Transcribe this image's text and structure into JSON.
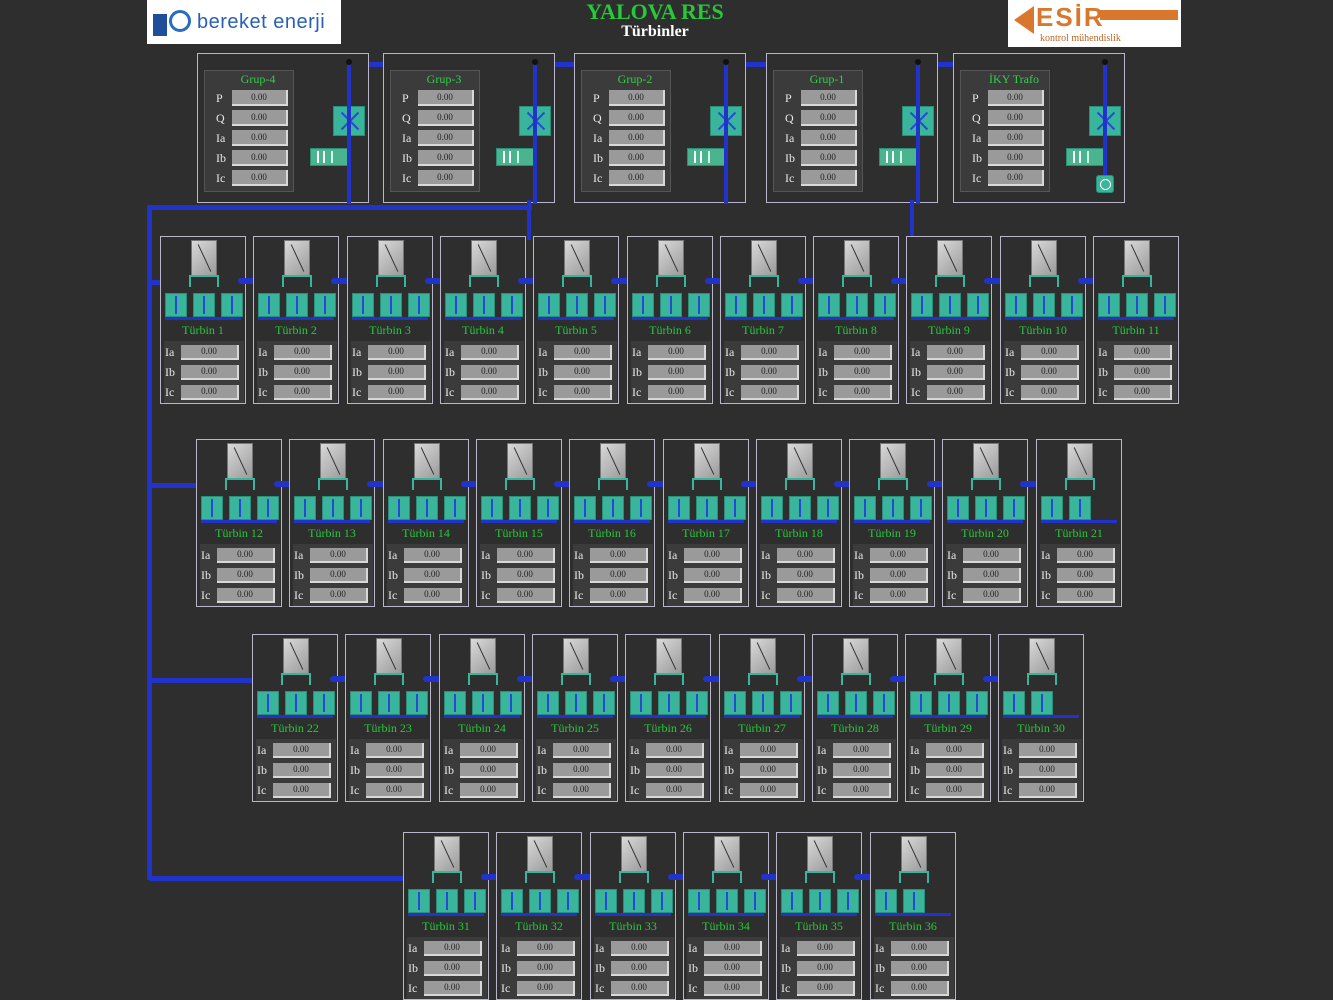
{
  "header": {
    "title": "YALOVA RES",
    "subtitle": "Türbinler",
    "left_logo": "bereket enerji",
    "right_logo": "ESİR",
    "right_logo_sub": "kontrol mühendislik"
  },
  "feeders": [
    {
      "name": "Grup-4",
      "rows": [
        {
          "label": "P",
          "value": "0.00"
        },
        {
          "label": "Q",
          "value": "0.00"
        },
        {
          "label": "Ia",
          "value": "0.00"
        },
        {
          "label": "Ib",
          "value": "0.00"
        },
        {
          "label": "Ic",
          "value": "0.00"
        }
      ]
    },
    {
      "name": "Grup-3",
      "rows": [
        {
          "label": "P",
          "value": "0.00"
        },
        {
          "label": "Q",
          "value": "0.00"
        },
        {
          "label": "Ia",
          "value": "0.00"
        },
        {
          "label": "Ib",
          "value": "0.00"
        },
        {
          "label": "Ic",
          "value": "0.00"
        }
      ]
    },
    {
      "name": "Grup-2",
      "rows": [
        {
          "label": "P",
          "value": "0.00"
        },
        {
          "label": "Q",
          "value": "0.00"
        },
        {
          "label": "Ia",
          "value": "0.00"
        },
        {
          "label": "Ib",
          "value": "0.00"
        },
        {
          "label": "Ic",
          "value": "0.00"
        }
      ]
    },
    {
      "name": "Grup-1",
      "rows": [
        {
          "label": "P",
          "value": "0.00"
        },
        {
          "label": "Q",
          "value": "0.00"
        },
        {
          "label": "Ia",
          "value": "0.00"
        },
        {
          "label": "Ib",
          "value": "0.00"
        },
        {
          "label": "Ic",
          "value": "0.00"
        }
      ]
    },
    {
      "name": "İKY Trafo",
      "rows": [
        {
          "label": "P",
          "value": "0.00"
        },
        {
          "label": "Q",
          "value": "0.00"
        },
        {
          "label": "Ia",
          "value": "0.00"
        },
        {
          "label": "Ib",
          "value": "0.00"
        },
        {
          "label": "Ic",
          "value": "0.00"
        }
      ]
    }
  ],
  "turbines": [
    {
      "name": "Türbin 1",
      "ia": "0.00",
      "ib": "0.00",
      "ic": "0.00"
    },
    {
      "name": "Türbin 2",
      "ia": "0.00",
      "ib": "0.00",
      "ic": "0.00"
    },
    {
      "name": "Türbin 3",
      "ia": "0.00",
      "ib": "0.00",
      "ic": "0.00"
    },
    {
      "name": "Türbin 4",
      "ia": "0.00",
      "ib": "0.00",
      "ic": "0.00"
    },
    {
      "name": "Türbin 5",
      "ia": "0.00",
      "ib": "0.00",
      "ic": "0.00"
    },
    {
      "name": "Türbin 6",
      "ia": "0.00",
      "ib": "0.00",
      "ic": "0.00"
    },
    {
      "name": "Türbin 7",
      "ia": "0.00",
      "ib": "0.00",
      "ic": "0.00"
    },
    {
      "name": "Türbin 8",
      "ia": "0.00",
      "ib": "0.00",
      "ic": "0.00"
    },
    {
      "name": "Türbin 9",
      "ia": "0.00",
      "ib": "0.00",
      "ic": "0.00"
    },
    {
      "name": "Türbin 10",
      "ia": "0.00",
      "ib": "0.00",
      "ic": "0.00"
    },
    {
      "name": "Türbin 11",
      "ia": "0.00",
      "ib": "0.00",
      "ic": "0.00"
    },
    {
      "name": "Türbin 12",
      "ia": "0.00",
      "ib": "0.00",
      "ic": "0.00"
    },
    {
      "name": "Türbin 13",
      "ia": "0.00",
      "ib": "0.00",
      "ic": "0.00"
    },
    {
      "name": "Türbin 14",
      "ia": "0.00",
      "ib": "0.00",
      "ic": "0.00"
    },
    {
      "name": "Türbin 15",
      "ia": "0.00",
      "ib": "0.00",
      "ic": "0.00"
    },
    {
      "name": "Türbin 16",
      "ia": "0.00",
      "ib": "0.00",
      "ic": "0.00"
    },
    {
      "name": "Türbin 17",
      "ia": "0.00",
      "ib": "0.00",
      "ic": "0.00"
    },
    {
      "name": "Türbin 18",
      "ia": "0.00",
      "ib": "0.00",
      "ic": "0.00"
    },
    {
      "name": "Türbin 19",
      "ia": "0.00",
      "ib": "0.00",
      "ic": "0.00"
    },
    {
      "name": "Türbin 20",
      "ia": "0.00",
      "ib": "0.00",
      "ic": "0.00"
    },
    {
      "name": "Türbin 21",
      "ia": "0.00",
      "ib": "0.00",
      "ic": "0.00"
    },
    {
      "name": "Türbin 22",
      "ia": "0.00",
      "ib": "0.00",
      "ic": "0.00"
    },
    {
      "name": "Türbin 23",
      "ia": "0.00",
      "ib": "0.00",
      "ic": "0.00"
    },
    {
      "name": "Türbin 24",
      "ia": "0.00",
      "ib": "0.00",
      "ic": "0.00"
    },
    {
      "name": "Türbin 25",
      "ia": "0.00",
      "ib": "0.00",
      "ic": "0.00"
    },
    {
      "name": "Türbin 26",
      "ia": "0.00",
      "ib": "0.00",
      "ic": "0.00"
    },
    {
      "name": "Türbin 27",
      "ia": "0.00",
      "ib": "0.00",
      "ic": "0.00"
    },
    {
      "name": "Türbin 28",
      "ia": "0.00",
      "ib": "0.00",
      "ic": "0.00"
    },
    {
      "name": "Türbin 29",
      "ia": "0.00",
      "ib": "0.00",
      "ic": "0.00"
    },
    {
      "name": "Türbin 30",
      "ia": "0.00",
      "ib": "0.00",
      "ic": "0.00"
    },
    {
      "name": "Türbin 31",
      "ia": "0.00",
      "ib": "0.00",
      "ic": "0.00"
    },
    {
      "name": "Türbin 32",
      "ia": "0.00",
      "ib": "0.00",
      "ic": "0.00"
    },
    {
      "name": "Türbin 33",
      "ia": "0.00",
      "ib": "0.00",
      "ic": "0.00"
    },
    {
      "name": "Türbin 34",
      "ia": "0.00",
      "ib": "0.00",
      "ic": "0.00"
    },
    {
      "name": "Türbin 35",
      "ia": "0.00",
      "ib": "0.00",
      "ic": "0.00"
    },
    {
      "name": "Türbin 36",
      "ia": "0.00",
      "ib": "0.00",
      "ic": "0.00"
    }
  ],
  "turbine_labels": {
    "ia": "Ia",
    "ib": "Ib",
    "ic": "Ic"
  },
  "colors": {
    "background": "#2e2e2e",
    "bus": "#2133c8",
    "equipment": "#38b59a",
    "label_green": "#26c93a",
    "value_box": "#9a9a9a"
  }
}
